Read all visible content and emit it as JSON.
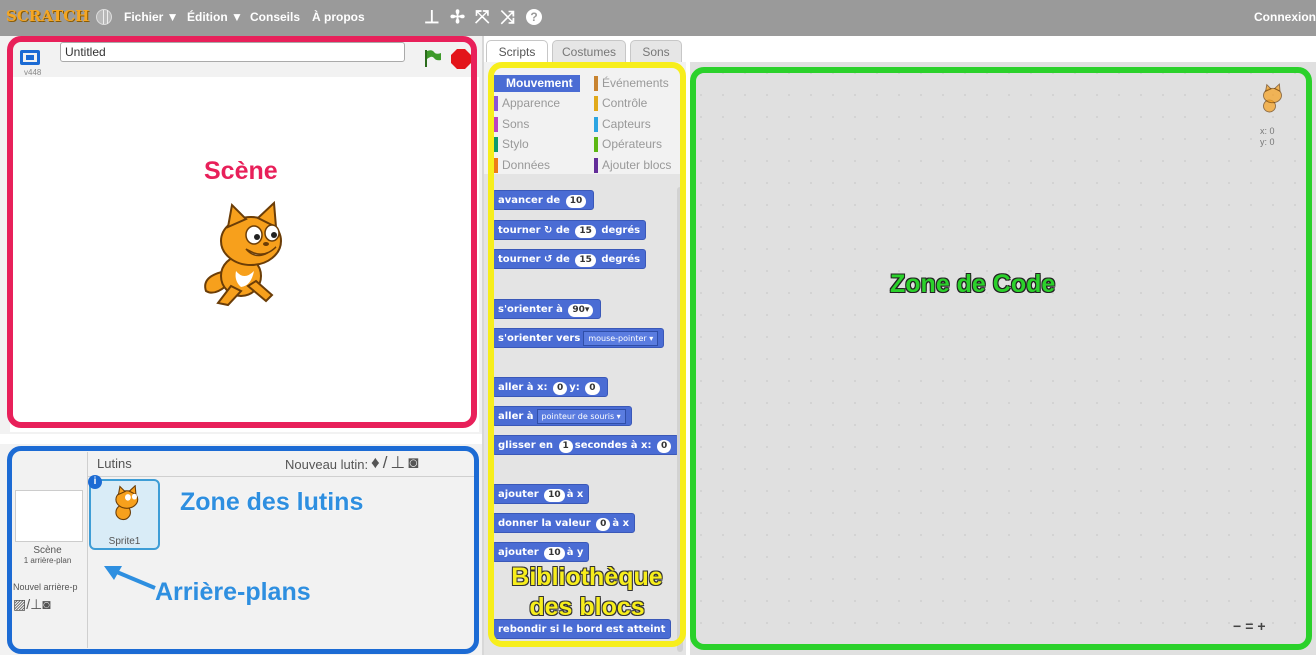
{
  "menubar": {
    "logo": "SCRATCH",
    "items": [
      "Fichier ▼",
      "Édition ▼",
      "Conseils",
      "À propos"
    ],
    "tools": [
      "duplicate-icon",
      "delete-icon",
      "grow-icon",
      "shrink-icon",
      "help-icon"
    ],
    "login": "Connexion"
  },
  "stage": {
    "title": "Untitled",
    "version": "v448",
    "label": "Scène"
  },
  "sprites": {
    "stage_thumb_label": "Scène",
    "stage_thumb_count": "1 arrière-plan",
    "new_backdrop_label": "Nouvel arrière-p",
    "header": "Lutins",
    "new_sprite_label": "Nouveau lutin:",
    "sprite_name": "Sprite1",
    "zone_label": "Zone des lutins",
    "backdrop_label": "Arrière-plans"
  },
  "tabs": [
    "Scripts",
    "Costumes",
    "Sons"
  ],
  "categories": [
    {
      "label": "Mouvement",
      "color": "#4a6cd4"
    },
    {
      "label": "Événements",
      "color": "#c88330"
    },
    {
      "label": "Apparence",
      "color": "#8a55d7"
    },
    {
      "label": "Contrôle",
      "color": "#e1a91a"
    },
    {
      "label": "Sons",
      "color": "#bb42c3"
    },
    {
      "label": "Capteurs",
      "color": "#2ca5e2"
    },
    {
      "label": "Stylo",
      "color": "#0e9a6c"
    },
    {
      "label": "Opérateurs",
      "color": "#5cb712"
    },
    {
      "label": "Données",
      "color": "#ee7d16"
    },
    {
      "label": "Ajouter blocs",
      "color": "#632d99"
    }
  ],
  "blocks": {
    "b1": "avancer de",
    "b1n": "10",
    "b2a": "tourner ↻ de",
    "b2n": "15",
    "b2b": "degrés",
    "b3a": "tourner ↺ de",
    "b3n": "15",
    "b3b": "degrés",
    "b4": "s'orienter à",
    "b4n": "90▾",
    "b5": "s'orienter vers",
    "b5d": "mouse-pointer ▾",
    "b6a": "aller à x:",
    "b6n1": "0",
    "b6b": "y:",
    "b6n2": "0",
    "b7": "aller à",
    "b7d": "pointeur de souris ▾",
    "b8a": "glisser en",
    "b8n1": "1",
    "b8b": "secondes à x:",
    "b8n2": "0",
    "b9a": "ajouter",
    "b9n": "10",
    "b9b": "à x",
    "b10a": "donner la valeur",
    "b10n": "0",
    "b10b": "à x",
    "b11a": "ajouter",
    "b11n": "10",
    "b11b": "à y",
    "b12": "rebondir si le bord est atteint"
  },
  "palette_label_line1": "Bibliothèque",
  "palette_label_line2": "des blocs",
  "code": {
    "label": "Zone de Code",
    "x": "x: 0",
    "y": "y: 0",
    "zoom": "- = +"
  },
  "colors": {
    "stage_frame": "#e8205a",
    "sprite_frame": "#1c6bd4",
    "palette_frame": "#f7ee1c",
    "code_frame": "#2bd12b"
  }
}
